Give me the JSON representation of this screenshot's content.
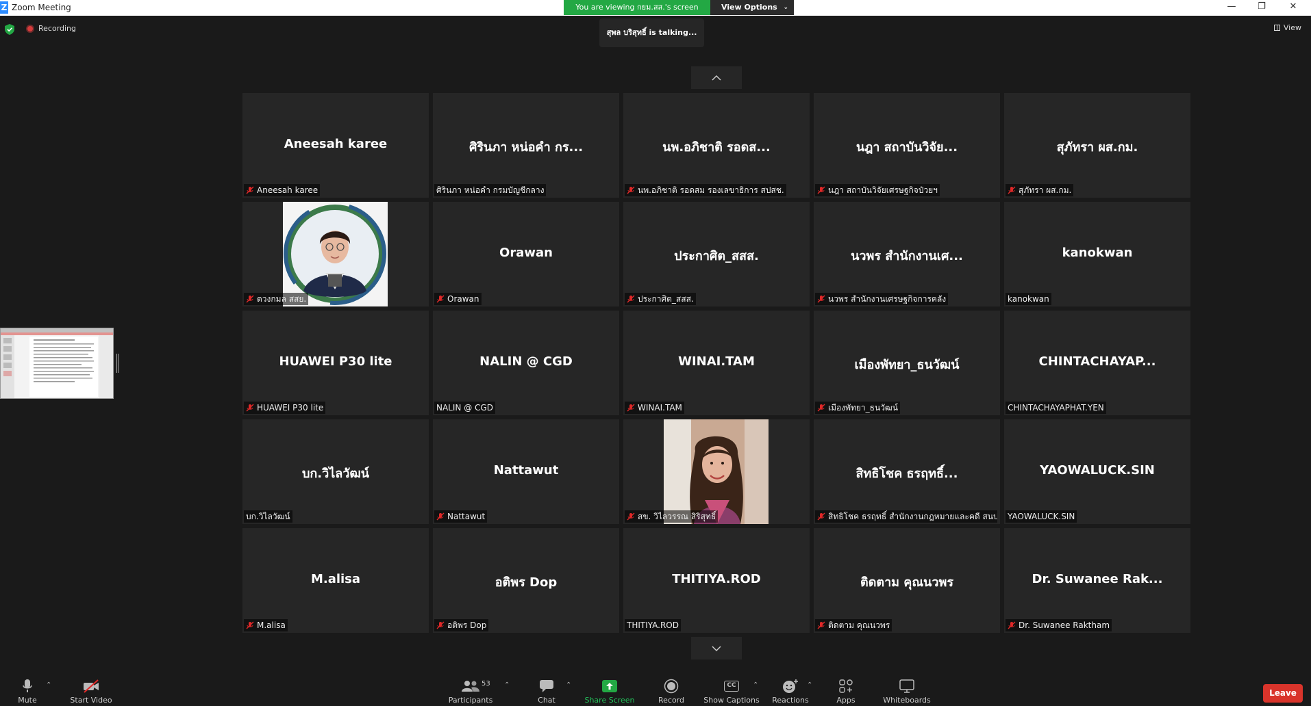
{
  "window": {
    "title": "Zoom Meeting",
    "app_logo": "Z",
    "viewing_banner": "You are viewing กยม.สส.'s screen",
    "view_options_label": "View Options"
  },
  "status": {
    "recording_label": "Recording",
    "talking_text": "สุพล บริสุทธิ์ is  talking...",
    "view_label": "View"
  },
  "tiles": [
    {
      "big": "Aneesah karee",
      "label": "Aneesah karee",
      "muted": true
    },
    {
      "big": "ศิรินภา หน่อคำ กร...",
      "label": "ศิรินภา หน่อคำ กรมบัญชีกลาง",
      "muted": false
    },
    {
      "big": "นพ.อภิชาติ รอดส...",
      "label": "นพ.อภิชาติ รอดสม รองเลขาธิการ สปสช.",
      "muted": true
    },
    {
      "big": "นฎา  สถาบันวิจัย...",
      "label": "นฎา  สถาบันวิจัยเศรษฐกิจป๋วยฯ",
      "muted": true
    },
    {
      "big": "สุภัทรา ผส.กม.",
      "label": "สุภัทรา ผส.กม.",
      "muted": true
    },
    {
      "big": "",
      "label": "ดวงกมล สสย.",
      "muted": true,
      "photo": "woman-glasses"
    },
    {
      "big": "Orawan",
      "label": "Orawan",
      "muted": true
    },
    {
      "big": "ประกาศิต_สสส.",
      "label": "ประกาศิต_สสส.",
      "muted": true
    },
    {
      "big": "นวพร สำนักงานเศ...",
      "label": "นวพร สำนักงานเศรษฐกิจการคลัง",
      "muted": true
    },
    {
      "big": "kanokwan",
      "label": "kanokwan",
      "muted": false
    },
    {
      "big": "HUAWEI P30 lite",
      "label": "HUAWEI P30 lite",
      "muted": true
    },
    {
      "big": "NALIN @ CGD",
      "label": "NALIN @ CGD",
      "muted": false
    },
    {
      "big": "WINAI.TAM",
      "label": "WINAI.TAM",
      "muted": true
    },
    {
      "big": "เมืองพัทยา_ธนวัฒน์",
      "label": "เมืองพัทยา_ธนวัฒน์",
      "muted": true
    },
    {
      "big": "CHINTACHAYAP...",
      "label": "CHINTACHAYAPHAT.YEN",
      "muted": false
    },
    {
      "big": "บก.วิไลวัฒน์",
      "label": "บก.วิไลวัฒน์",
      "muted": false
    },
    {
      "big": "Nattawut",
      "label": "Nattawut",
      "muted": true
    },
    {
      "big": "",
      "label": "สข. วิไลวรรณ สิริสุทธิ์",
      "muted": true,
      "photo": "woman-portrait"
    },
    {
      "big": "สิทธิโชค ธรฤทธิ์...",
      "label": "สิทธิโชค ธรฤทธิ์  สำนักงานกฎหมายและคดี สนป...",
      "muted": true
    },
    {
      "big": "YAOWALUCK.SIN",
      "label": "YAOWALUCK.SIN",
      "muted": false
    },
    {
      "big": "M.alisa",
      "label": "M.alisa",
      "muted": true
    },
    {
      "big": "อติพร Dop",
      "label": "อติพร Dop",
      "muted": true
    },
    {
      "big": "THITIYA.ROD",
      "label": "THITIYA.ROD",
      "muted": false
    },
    {
      "big": "ติดตาม คุณนวพร",
      "label": "ติดตาม คุณนวพร",
      "muted": true
    },
    {
      "big": "Dr. Suwanee Rak...",
      "label": "Dr. Suwanee Raktham",
      "muted": true
    }
  ],
  "toolbar": {
    "mute": "Mute",
    "start_video": "Start Video",
    "participants": "Participants",
    "participants_count": "53",
    "chat": "Chat",
    "share_screen": "Share Screen",
    "record": "Record",
    "show_captions": "Show Captions",
    "captions_icon_text": "CC",
    "reactions": "Reactions",
    "apps": "Apps",
    "whiteboards": "Whiteboards",
    "leave": "Leave"
  },
  "colors": {
    "share_green": "#23a844",
    "leave_red": "#d9342b",
    "tile_bg": "#262626",
    "mute_red": "#e02828"
  }
}
